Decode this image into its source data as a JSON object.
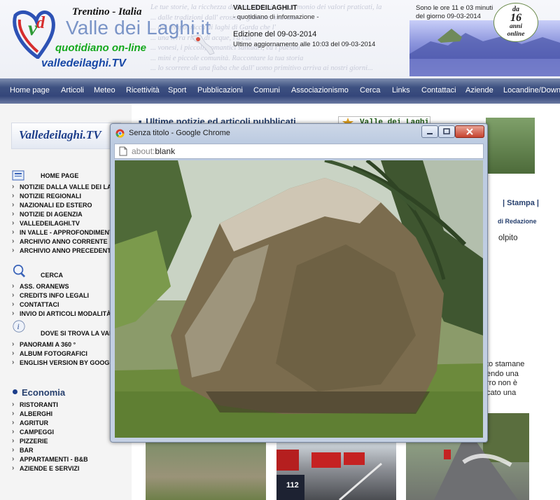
{
  "header": {
    "region": "Trentino - Italia",
    "site_title": "Valle dei Laghi.it",
    "tagline": "quotidiano on-line",
    "tv_link": "valledeilaghi.TV",
    "masthead": "VALLEDEILAGHI.IT",
    "subhead": "- quotidiano di informazione -",
    "edition": "Edizione del 09-03-2014",
    "last_update": "Ultimo aggiornamento alle 10:03 del 09-03-2014",
    "clock_line1": "Sono le ore 11 e 03 minuti",
    "clock_line2": "del giorno 09-03-2014",
    "badge_top": "da",
    "badge_number": "16",
    "badge_line1": "anni",
    "badge_line2": "online",
    "ghost_lines": [
      "Le tue storie, la ricchezza delle tradizioni, il patrimonio dei valori praticati, la",
      "... dalle tradizioni dall' erosione glaciale, scavata",
      "... del tempo, ricca di laghi di Garda che l'",
      "... una terra ricca di acque, l'a cui",
      "... vonesi, i piccoli, romantici santuari, ed i paesini",
      "... mini e piccole comunità. Raccontare la tua storia",
      "... lo scorrere di una fiaba che dall' uomo primitivo arriva ai nostri giorni..."
    ]
  },
  "nav": [
    "Home page",
    "Articoli",
    "Meteo",
    "Ricettività",
    "Sport",
    "Pubblicazioni",
    "Comuni",
    "Associazionismo",
    "Cerca",
    "Links",
    "Contattaci",
    "Aziende",
    "Locandine/Down"
  ],
  "sidebar": {
    "tv_logo": "Valledeilaghi.TV",
    "group1": [
      "HOME PAGE",
      "NOTIZIE DALLA VALLE DEI LAGHI",
      "NOTIZIE REGIONALI",
      "NAZIONALI ED ESTERO",
      "NOTIZIE DI AGENZIA",
      "VALLEDEILAGHI.TV",
      "IN VALLE - APPROFONDIMENTI",
      "ARCHIVIO ANNO CORRENTE",
      "ARCHIVIO ANNO PRECEDENTE"
    ],
    "group2": [
      "CERCA",
      "ASS. ORANEWS",
      "CREDITS INFO LEGALI",
      "CONTATTACI",
      "INVIO DI ARTICOLI MODALITÀ"
    ],
    "group3": [
      "DOVE SI TROVA LA VALLE",
      "PANORAMI A 360 °",
      "ALBUM FOTOGRAFICI",
      "ENGLISH VERSION BY GOOGLE"
    ],
    "economy_title": "Economia",
    "economy": [
      "RISTORANTI",
      "ALBERGHI",
      "AGRITUR",
      "CAMPEGGI",
      "PIZZERIE",
      "BAR",
      "APPARTAMENTI - B&B",
      "AZIENDE E SERVIZI"
    ]
  },
  "main": {
    "news_title": "Ultime notizie ed articoli pubblicati",
    "vdl_box": "Valle dei Laghi",
    "stampa": "| Stampa |",
    "redazione": "di Redazione",
    "article_fragment": "olpito",
    "article_lines": [
      "to stamane",
      "endo una",
      "rro non è",
      "cato una"
    ]
  },
  "popup": {
    "title": "Senza titolo - Google Chrome",
    "url_prefix": "about:",
    "url_main": "blank"
  }
}
